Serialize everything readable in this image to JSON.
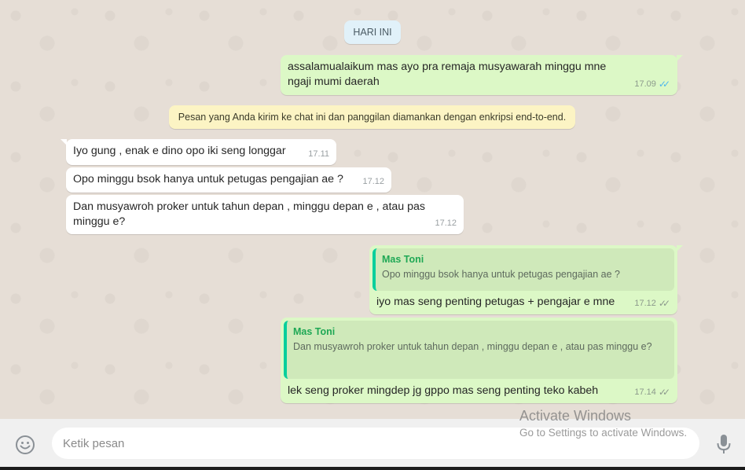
{
  "chat": {
    "day_label": "HARI INI",
    "encryption_notice": "Pesan yang Anda kirim ke chat ini dan panggilan diamankan dengan enkripsi end-to-end.",
    "messages": [
      {
        "text": "assalamualaikum mas ayo pra remaja musyawarah minggu mne ngaji mumi daerah",
        "time": "17.09",
        "status": "read"
      },
      {
        "text": "Iyo gung , enak e dino opo iki seng longgar",
        "time": "17.11"
      },
      {
        "text": "Opo minggu bsok hanya untuk petugas pengajian ae ?",
        "time": "17.12"
      },
      {
        "text": "Dan musyawroh proker untuk tahun depan , minggu depan e , atau pas minggu e?",
        "time": "17.12"
      },
      {
        "quote_author": "Mas Toni",
        "quote_text": "Opo minggu bsok hanya untuk petugas pengajian ae ?",
        "text": "iyo mas seng penting petugas + pengajar e mne",
        "time": "17.12",
        "status": "sent"
      },
      {
        "quote_author": "Mas Toni",
        "quote_text": "Dan musyawroh proker untuk tahun depan , minggu depan e , atau pas minggu e?",
        "text": "lek seng proker mingdep jg gppo mas seng penting teko kabeh",
        "time": "17.14",
        "status": "sent"
      }
    ]
  },
  "composer": {
    "placeholder": "Ketik pesan",
    "emoji_icon": "smiley-icon",
    "mic_icon": "microphone-icon"
  },
  "watermark": {
    "title": "Activate Windows",
    "subtitle": "Go to Settings to activate Windows."
  },
  "colors": {
    "outgoing_bubble": "#dcf8c6",
    "incoming_bubble": "#ffffff",
    "quote_accent": "#06cf9c",
    "quote_author": "#1fa855",
    "read_ticks": "#4fb6ec"
  }
}
